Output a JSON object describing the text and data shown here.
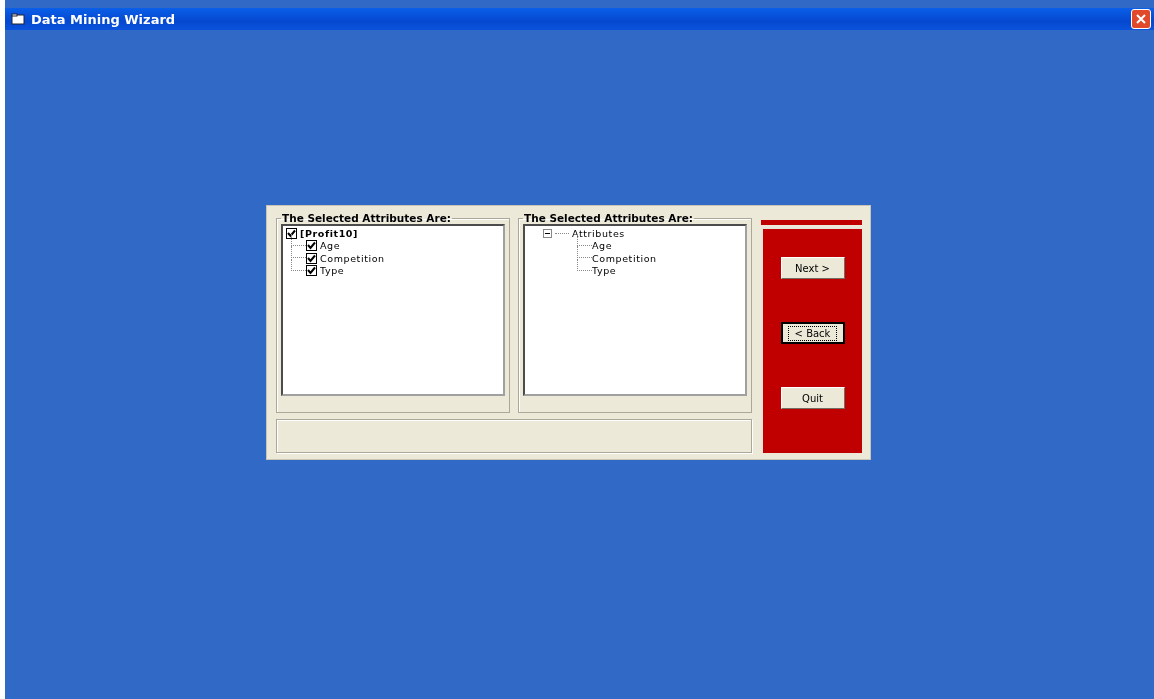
{
  "window": {
    "title": "Data Mining Wizard"
  },
  "left_panel": {
    "title": "The Selected Attributes Are:",
    "tree": [
      {
        "label": "[Profit10]",
        "checked": true,
        "children": [
          {
            "label": "Age",
            "checked": true
          },
          {
            "label": "Competition",
            "checked": true
          },
          {
            "label": "Type",
            "checked": true
          }
        ]
      }
    ]
  },
  "right_panel": {
    "title": "The Selected Attributes Are:",
    "tree": [
      {
        "label": "Attributes",
        "expanded": true,
        "children": [
          {
            "label": "Age"
          },
          {
            "label": "Competition"
          },
          {
            "label": "Type"
          }
        ]
      }
    ]
  },
  "buttons": [
    {
      "label": "Next >",
      "focused": false
    },
    {
      "label": "< Back",
      "focused": true
    },
    {
      "label": "Quit",
      "focused": false
    }
  ]
}
